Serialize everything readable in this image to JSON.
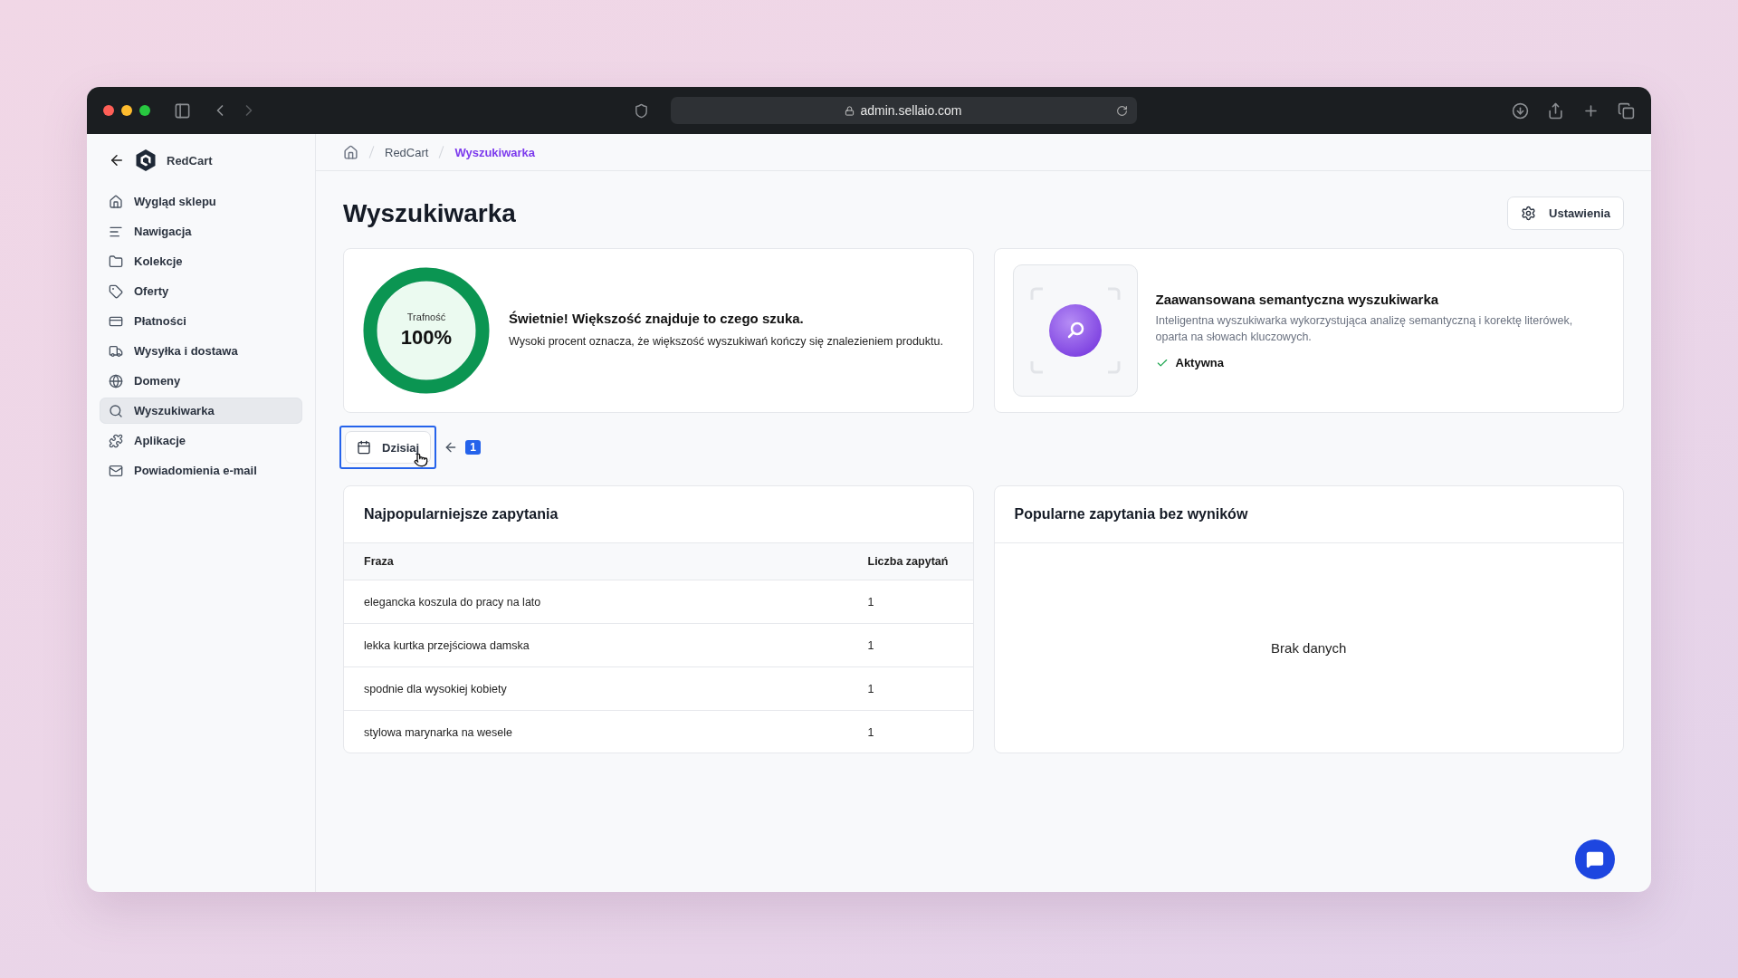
{
  "browser": {
    "url": "admin.sellaio.com"
  },
  "sidebar": {
    "store_name": "RedCart",
    "items": [
      {
        "label": "Wygląd sklepu",
        "selected": false
      },
      {
        "label": "Nawigacja",
        "selected": false
      },
      {
        "label": "Kolekcje",
        "selected": false
      },
      {
        "label": "Oferty",
        "selected": false
      },
      {
        "label": "Płatności",
        "selected": false
      },
      {
        "label": "Wysyłka i dostawa",
        "selected": false
      },
      {
        "label": "Domeny",
        "selected": false
      },
      {
        "label": "Wyszukiwarka",
        "selected": true
      },
      {
        "label": "Aplikacje",
        "selected": false
      },
      {
        "label": "Powiadomienia e-mail",
        "selected": false
      }
    ]
  },
  "breadcrumb": [
    {
      "label": "RedCart",
      "selected": false
    },
    {
      "label": "Wyszukiwarka",
      "selected": true
    }
  ],
  "page": {
    "title": "Wyszukiwarka",
    "settings_button": "Ustawienia"
  },
  "accuracy_card": {
    "label": "Trafność",
    "value": "100%",
    "level": 1,
    "headline": "Świetnie! Większość znajduje to czego szuka.",
    "description": "Wysoki procent oznacza, że większość wyszukiwań kończy się znalezieniem produktu."
  },
  "semantic_card": {
    "title": "Zaawansowana semantyczna wyszukiwarka",
    "description": "Inteligentna wyszukiwarka wykorzystująca analizę semantyczną i korektę literówek, oparta na słowach kluczowych.",
    "status": "Aktywna",
    "active": true
  },
  "date_filter": {
    "label": "Dzisiaj",
    "highlighted": true
  },
  "annotation": {
    "number": "1"
  },
  "top_queries": {
    "title": "Najpopularniejsze zapytania",
    "columns": [
      "Fraza",
      "Liczba zapytań"
    ],
    "rows": [
      [
        "elegancka koszula do pracy na lato",
        "1"
      ],
      [
        "lekka kurtka przejściowa damska",
        "1"
      ],
      [
        "spodnie dla wysokiej kobiety",
        "1"
      ],
      [
        "stylowa marynarka na wesele",
        "1"
      ]
    ]
  },
  "no_results": {
    "title": "Popularne zapytania bez wyników",
    "empty_text": "Brak danych"
  }
}
